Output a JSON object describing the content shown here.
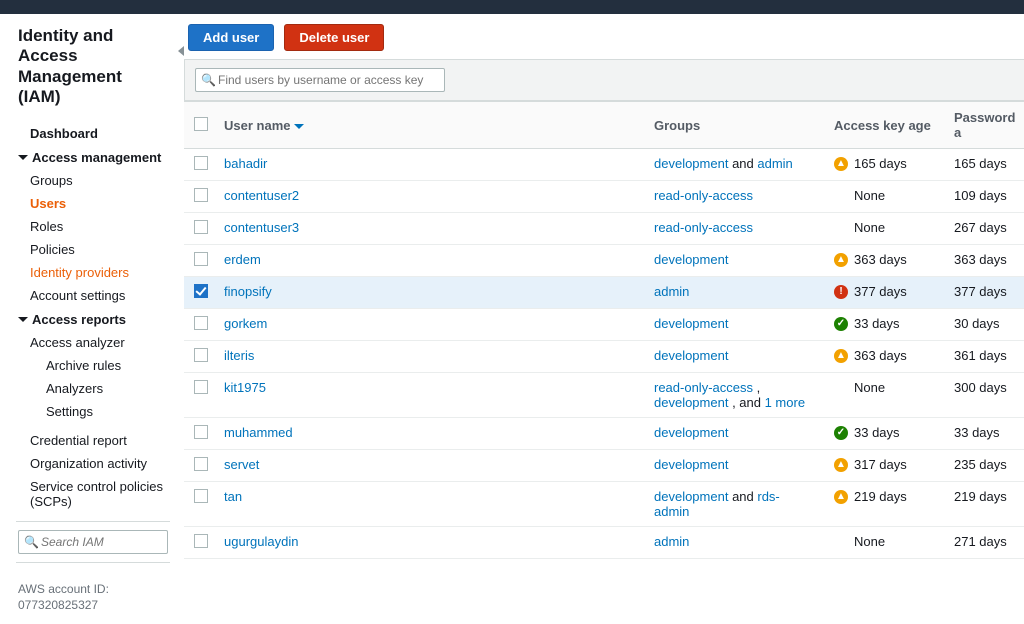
{
  "serviceTitle": "Identity and Access Management (IAM)",
  "sidebar": {
    "dashboard": "Dashboard",
    "accessMgmt": "Access management",
    "items": [
      "Groups",
      "Users",
      "Roles",
      "Policies",
      "Identity providers",
      "Account settings"
    ],
    "accessReports": "Access reports",
    "reports": [
      "Access analyzer",
      "Archive rules",
      "Analyzers",
      "Settings"
    ],
    "other": [
      "Credential report",
      "Organization activity",
      "Service control policies (SCPs)"
    ],
    "searchPlaceholder": "Search IAM",
    "accountLabel": "AWS account ID:",
    "accountId": "077320825327"
  },
  "buttons": {
    "add": "Add user",
    "delete": "Delete user"
  },
  "filterPlaceholder": "Find users by username or access key",
  "columns": {
    "name": "User name",
    "groups": "Groups",
    "age": "Access key age",
    "pw": "Password a"
  },
  "joiners": {
    "and": " and ",
    "comma": " , ",
    "more": " 1 more"
  },
  "users": [
    {
      "name": "bahadir",
      "groups": [
        {
          "text": "development"
        },
        {
          "plain": " and "
        },
        {
          "text": "admin"
        }
      ],
      "ageIcon": "warn",
      "age": "165 days",
      "pw": "165 days",
      "checked": false
    },
    {
      "name": "contentuser2",
      "groups": [
        {
          "text": "read-only-access"
        }
      ],
      "ageIcon": "",
      "age": "None",
      "pw": "109 days",
      "checked": false
    },
    {
      "name": "contentuser3",
      "groups": [
        {
          "text": "read-only-access"
        }
      ],
      "ageIcon": "",
      "age": "None",
      "pw": "267 days",
      "checked": false
    },
    {
      "name": "erdem",
      "groups": [
        {
          "text": "development"
        }
      ],
      "ageIcon": "warn",
      "age": "363 days",
      "pw": "363 days",
      "checked": false
    },
    {
      "name": "finopsify",
      "groups": [
        {
          "text": "admin"
        }
      ],
      "ageIcon": "crit",
      "age": "377 days",
      "pw": "377 days",
      "checked": true
    },
    {
      "name": "gorkem",
      "groups": [
        {
          "text": "development"
        }
      ],
      "ageIcon": "good",
      "age": "33 days",
      "pw": "30 days",
      "checked": false
    },
    {
      "name": "ilteris",
      "groups": [
        {
          "text": "development"
        }
      ],
      "ageIcon": "warn",
      "age": "363 days",
      "pw": "361 days",
      "checked": false
    },
    {
      "name": "kit1975",
      "groups": [
        {
          "text": "read-only-access"
        },
        {
          "plain": " , "
        },
        {
          "text": "development"
        },
        {
          "plain": " , and "
        },
        {
          "text": "1 more"
        }
      ],
      "ageIcon": "",
      "age": "None",
      "pw": "300 days",
      "checked": false
    },
    {
      "name": "muhammed",
      "groups": [
        {
          "text": "development"
        }
      ],
      "ageIcon": "good",
      "age": "33 days",
      "pw": "33 days",
      "checked": false
    },
    {
      "name": "servet",
      "groups": [
        {
          "text": "development"
        }
      ],
      "ageIcon": "warn",
      "age": "317 days",
      "pw": "235 days",
      "checked": false
    },
    {
      "name": "tan",
      "groups": [
        {
          "text": "development"
        },
        {
          "plain": " and "
        },
        {
          "text": "rds-admin"
        }
      ],
      "ageIcon": "warn",
      "age": "219 days",
      "pw": "219 days",
      "checked": false
    },
    {
      "name": "ugurgulaydin",
      "groups": [
        {
          "text": "admin"
        }
      ],
      "ageIcon": "",
      "age": "None",
      "pw": "271 days",
      "checked": false
    }
  ]
}
